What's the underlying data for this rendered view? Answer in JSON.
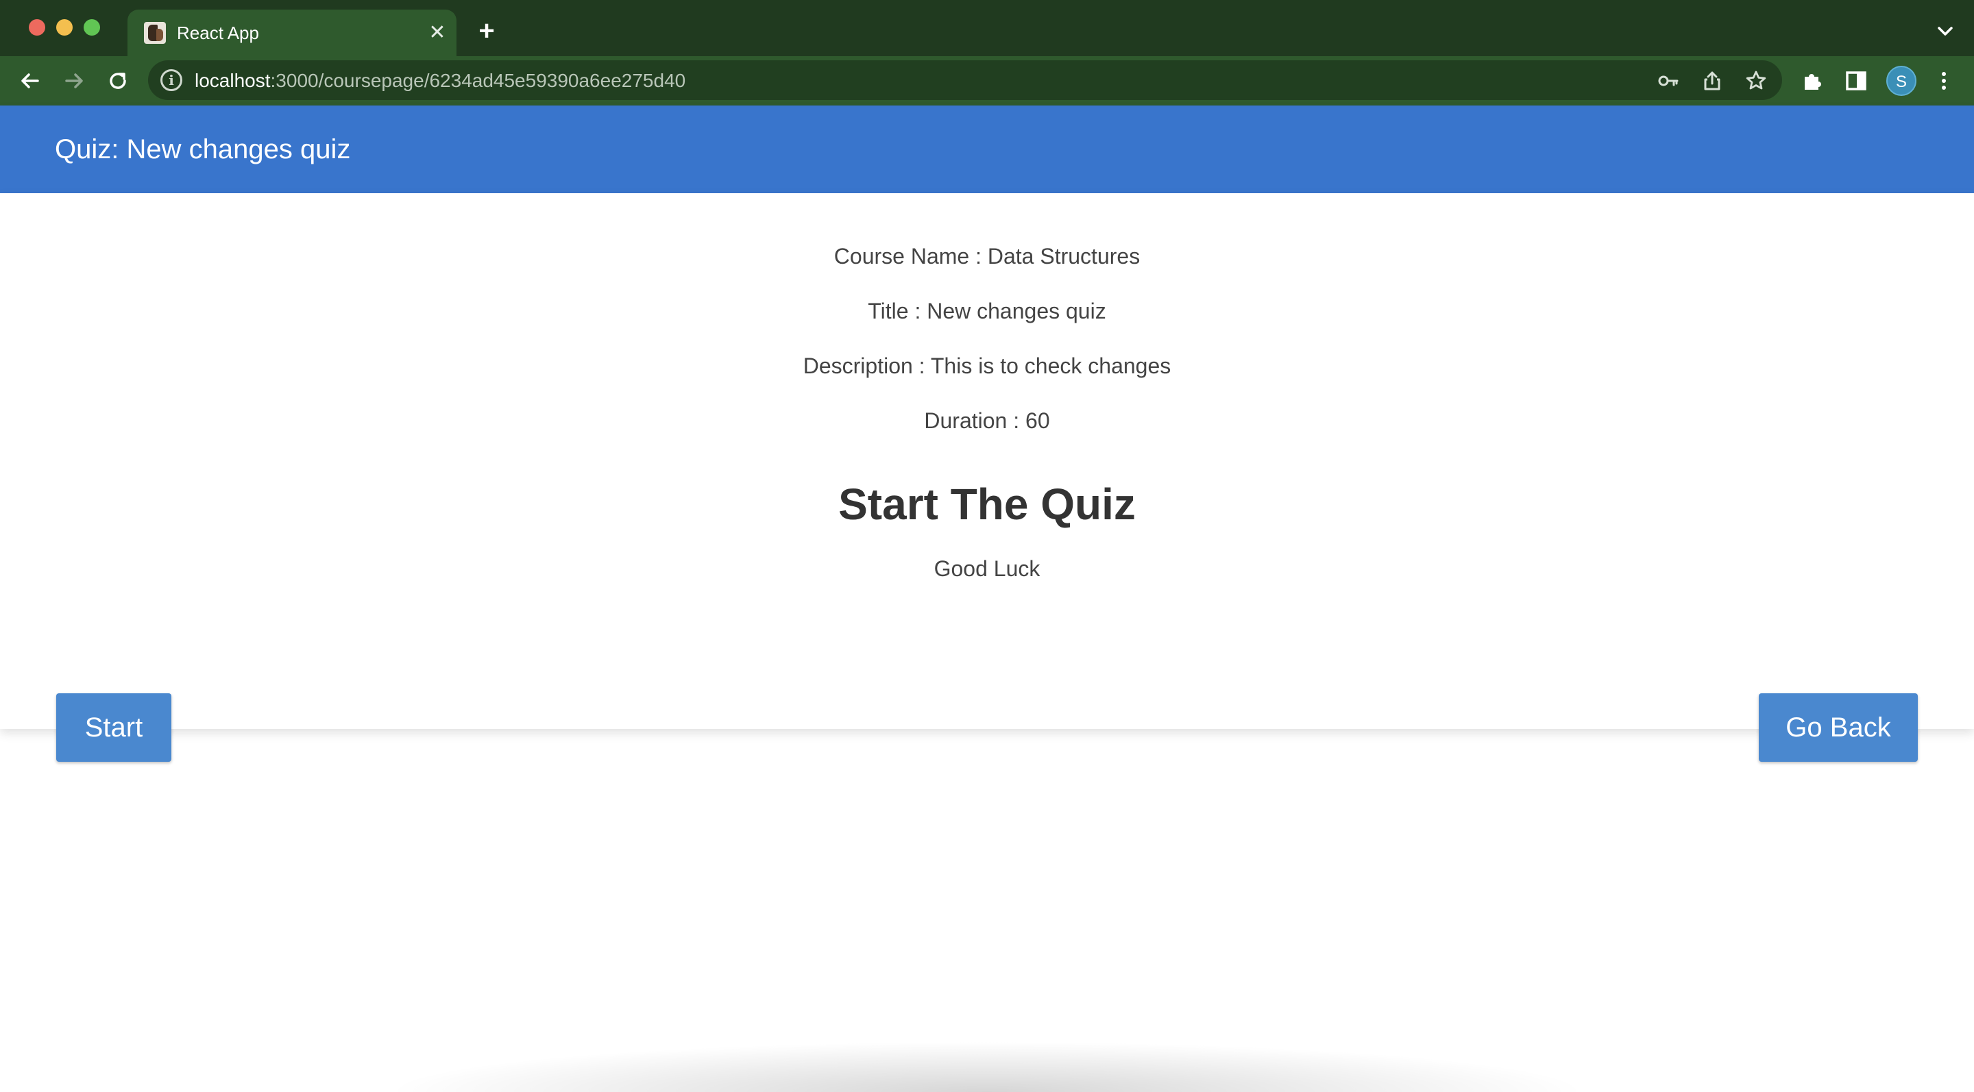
{
  "browser": {
    "tab": {
      "title": "React App",
      "favicon": "react-app-favicon",
      "close_glyph": "✕"
    },
    "new_tab_glyph": "+",
    "address": {
      "host": "localhost",
      "path": ":3000/coursepage/6234ad45e59390a6ee275d40"
    },
    "profile_initial": "S",
    "colors": {
      "tabstrip": "#203a1f",
      "toolbar": "#2f5a2d",
      "omnibox": "#213f20",
      "avatar": "#3a8fb7"
    }
  },
  "app_bar": {
    "title": "Quiz: New changes quiz",
    "color": "#3975cc"
  },
  "quiz": {
    "course_name": "Course Name : Data Structures",
    "title": "Title : New changes quiz",
    "description": "Description : This is to check changes",
    "duration": "Duration : 60",
    "heading": "Start The Quiz",
    "subheading": "Good Luck"
  },
  "actions": {
    "start_label": "Start",
    "go_back_label": "Go Back",
    "button_color": "#4a88cf"
  }
}
